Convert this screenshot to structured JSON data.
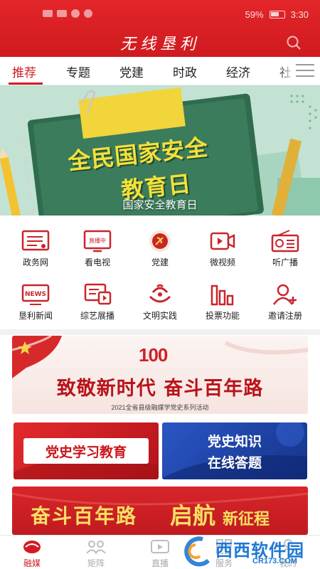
{
  "status_bar": {
    "battery": "59%",
    "time": "3:30"
  },
  "header": {
    "title": "无线垦利"
  },
  "tabs": [
    {
      "label": "推荐",
      "active": true
    },
    {
      "label": "专题"
    },
    {
      "label": "党建"
    },
    {
      "label": "时政"
    },
    {
      "label": "经济"
    },
    {
      "label": "社"
    }
  ],
  "banner": {
    "headline_line1": "全民国家安全",
    "headline_line2": "教育日",
    "caption": "国家安全教育日"
  },
  "grid": [
    {
      "label": "政务网",
      "icon": "gov-web-icon"
    },
    {
      "label": "看电视",
      "icon": "tv-icon"
    },
    {
      "label": "党建",
      "icon": "party-emblem-icon"
    },
    {
      "label": "微视频",
      "icon": "video-icon"
    },
    {
      "label": "听广播",
      "icon": "radio-icon"
    },
    {
      "label": "垦利新闻",
      "icon": "news-icon"
    },
    {
      "label": "综艺展播",
      "icon": "variety-icon"
    },
    {
      "label": "文明实践",
      "icon": "civilization-icon"
    },
    {
      "label": "投票功能",
      "icon": "vote-icon"
    },
    {
      "label": "邀请注册",
      "icon": "invite-user-icon"
    }
  ],
  "tv_icon_text": "直播中",
  "news_icon_text": "NEWS",
  "cards": {
    "centenary": {
      "number": "100",
      "title": "致敬新时代 奋斗百年路",
      "subtitle": "2021全省县级融媒学党史系列活动"
    },
    "study": {
      "title": "党史学习教育"
    },
    "quiz": {
      "line1": "党史知识",
      "line2": "在线答题"
    },
    "journey": {
      "title_a": "奋斗百年路",
      "title_b": "启航",
      "title_c": "新征程"
    }
  },
  "bottom_nav": [
    {
      "label": "融媒",
      "active": true
    },
    {
      "label": "矩阵"
    },
    {
      "label": "直播"
    },
    {
      "label": "服务"
    },
    {
      "label": "我的"
    }
  ],
  "watermark": {
    "brand": "西西软件园",
    "url": "CR173.COM"
  },
  "colors": {
    "brand_red": "#d21d22",
    "banner_green": "#2f6b4d",
    "headline_yellow": "#f5e03a",
    "quiz_blue": "#1b3f9e"
  }
}
